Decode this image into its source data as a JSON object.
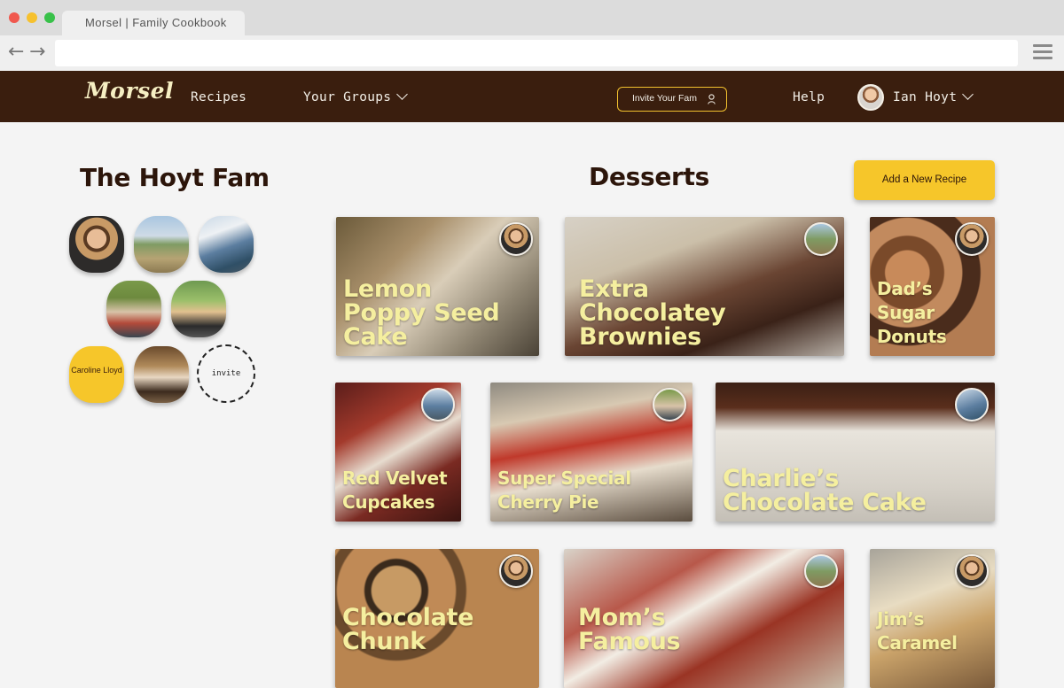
{
  "browser": {
    "tab_title": "Morsel | Family Cookbook"
  },
  "nav": {
    "logo": "Morsel",
    "recipes": "Recipes",
    "groups": "Your Groups",
    "invite": "Invite Your Fam",
    "help": "Help",
    "user": "Ian Hoyt"
  },
  "family": {
    "title": "The Hoyt Fam",
    "placeholder_member": "Caroline Lloyd",
    "invite": "invite"
  },
  "main": {
    "title": "Desserts",
    "add_button": "Add a  New Recipe",
    "recipes": [
      {
        "title": "Lemon Poppy Seed Cake"
      },
      {
        "title": "Extra Chocolatey Brownies"
      },
      {
        "title": "Dad’s Sugar Donuts"
      },
      {
        "title": "Red Velvet Cupcakes"
      },
      {
        "title": "Super Special Cherry Pie"
      },
      {
        "title": "Charlie’s Chocolate Cake"
      },
      {
        "title": "Chocolate Chunk"
      },
      {
        "title": "Mom’s Famous"
      },
      {
        "title": "Jim’s Caramel"
      }
    ]
  },
  "colors": {
    "nav_bg": "#3a1e0e",
    "accent": "#f6c62a",
    "card_title": "#f5ef9f"
  }
}
